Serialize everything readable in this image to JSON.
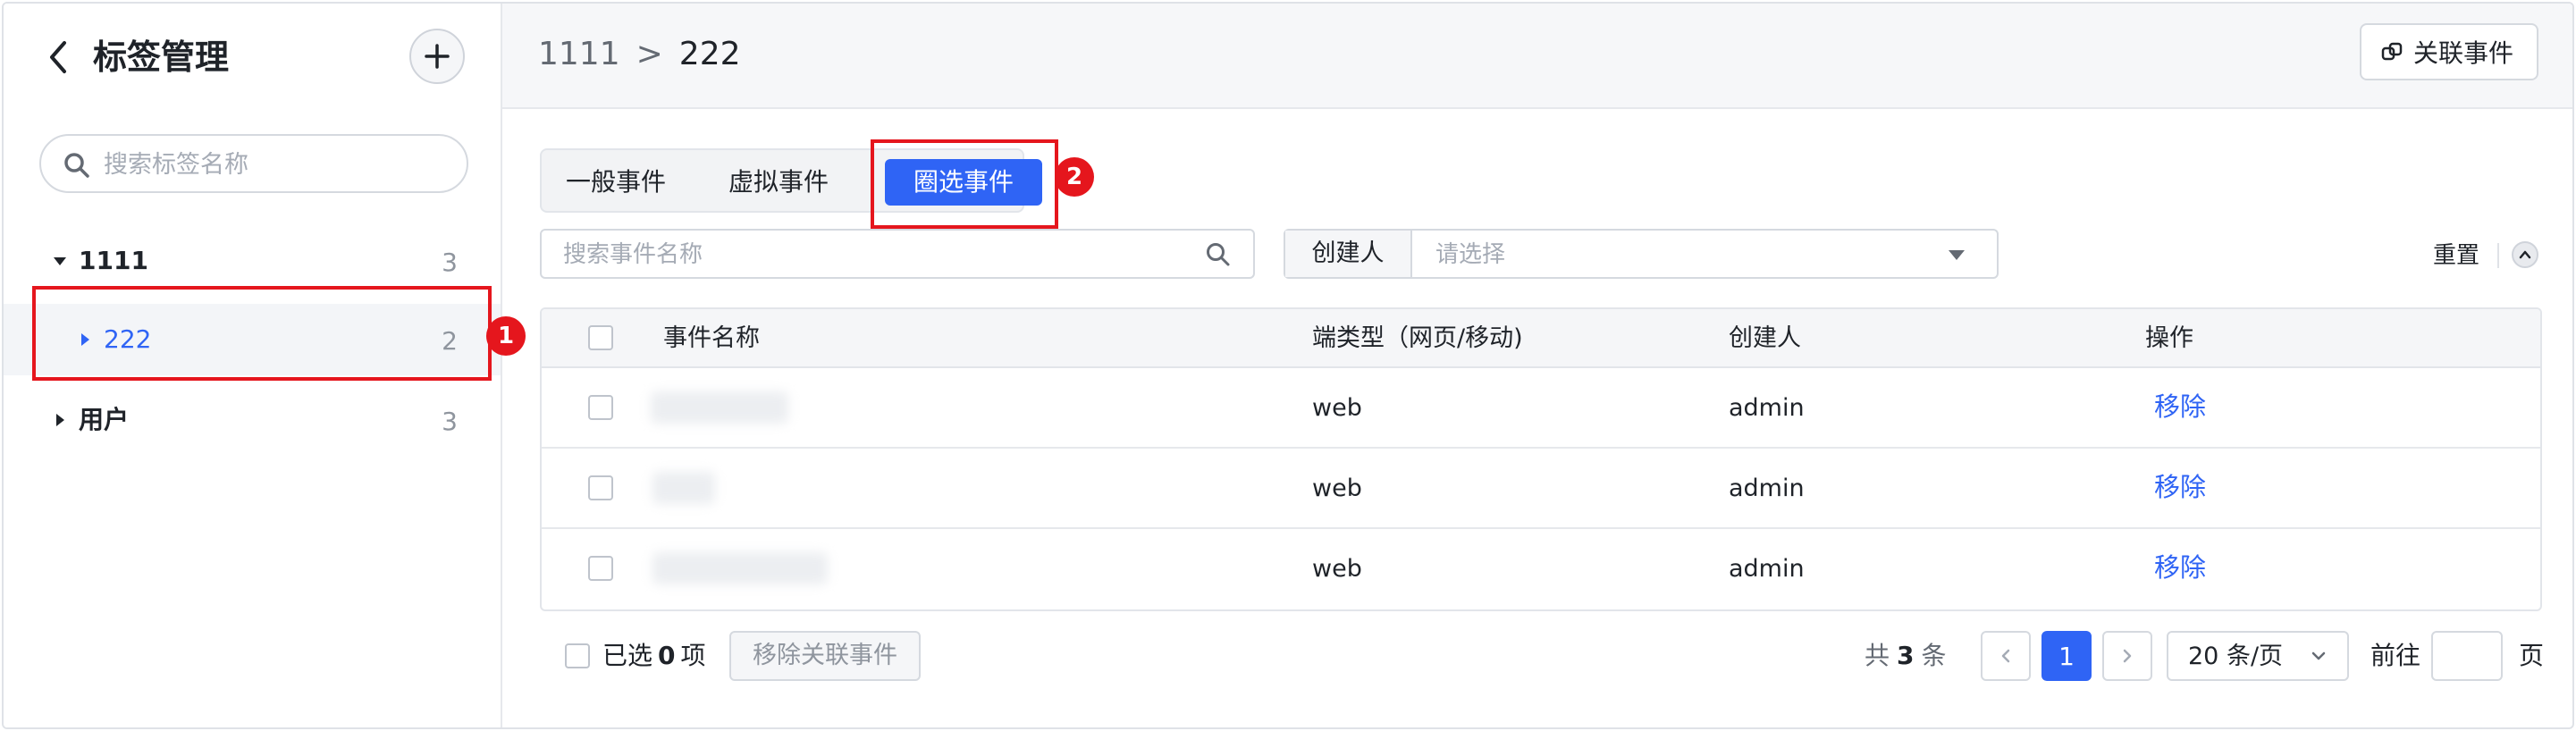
{
  "sidebar": {
    "title": "标签管理",
    "search_placeholder": "搜索标签名称",
    "tree": [
      {
        "label": "1111",
        "count": "3",
        "expanded": true
      },
      {
        "label": "222",
        "count": "2",
        "selected": true
      },
      {
        "label": "用户",
        "count": "3",
        "expanded": false
      }
    ]
  },
  "header": {
    "breadcrumb": [
      "1111",
      "222"
    ],
    "breadcrumb_sep": ">",
    "associate_button": "关联事件"
  },
  "tabs": [
    {
      "label": "一般事件"
    },
    {
      "label": "虚拟事件"
    },
    {
      "label": "圈选事件",
      "active": true
    }
  ],
  "filters": {
    "search_placeholder": "搜索事件名称",
    "creator_label": "创建人",
    "creator_placeholder": "请选择",
    "reset_label": "重置"
  },
  "table": {
    "columns": [
      "事件名称",
      "端类型（网页/移动)",
      "创建人",
      "操作"
    ],
    "rows": [
      {
        "platform": "web",
        "creator": "admin",
        "action": "移除"
      },
      {
        "platform": "web",
        "creator": "admin",
        "action": "移除"
      },
      {
        "platform": "web",
        "creator": "admin",
        "action": "移除"
      }
    ]
  },
  "footer": {
    "selected_prefix": "已选",
    "selected_count": "0",
    "selected_suffix": "项",
    "remove_button": "移除关联事件",
    "total_prefix": "共",
    "total_count": "3",
    "total_suffix": "条",
    "current_page": "1",
    "page_size": "20 条/页",
    "goto_label": "前往",
    "page_unit": "页"
  },
  "annotations": {
    "badge_1": "1",
    "badge_2": "2"
  },
  "colors": {
    "accent": "#2f64f5",
    "annotation_red": "#e5161d"
  },
  "icons": [
    "back-arrow-icon",
    "plus-icon",
    "search-icon",
    "link-icon",
    "caret-down-icon",
    "caret-right-icon",
    "chevron-up-icon",
    "chevron-left-icon",
    "chevron-right-icon",
    "chevron-down-icon"
  ]
}
